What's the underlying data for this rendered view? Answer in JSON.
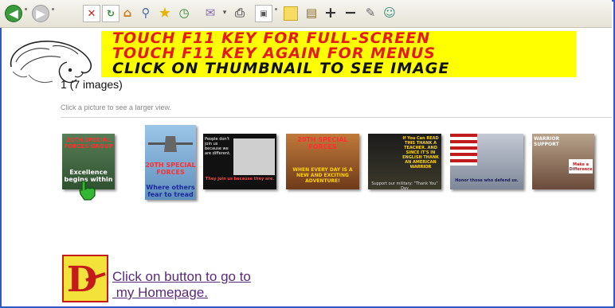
{
  "toolbar": {
    "icons": [
      "back-icon",
      "forward-icon",
      "stop-icon",
      "refresh-icon",
      "home-icon",
      "search-icon",
      "favorites-icon",
      "history-icon",
      "mail-icon",
      "print-icon",
      "edit-icon",
      "notes-icon",
      "research-icon",
      "zoom-in-icon",
      "zoom-out-icon",
      "messenger-icon",
      "people-icon"
    ],
    "zoom_in": "+",
    "zoom_out": "−"
  },
  "banner": {
    "line1": "TOUCH F11 KEY FOR FULL-SCREEN",
    "line2": "TOUCH F11 KEY AGAIN FOR MENUS",
    "line3": "CLICK ON THUMBNAIL TO SEE IMAGE",
    "background": "#ffff00",
    "accent_red": "#e31b1b"
  },
  "gallery": {
    "count": "1 (7 images)",
    "hint": "Click a picture to see a larger view.",
    "thumbnails": [
      {
        "caption_top": "20TH SPECIAL FORCES GROUP",
        "caption_bottom": "Excellence begins within"
      },
      {
        "caption_top": "20TH SPECIAL FORCES",
        "caption_bottom": "Where others fear to tread"
      },
      {
        "caption_top": "People don't join us because we are different.",
        "caption_bottom": "They join us because they are."
      },
      {
        "caption_top": "20TH SPECIAL FORCES",
        "caption_bottom": "WHEN EVERY DAY IS A NEW AND EXCITING ADVENTURE!"
      },
      {
        "caption_top": "If You Can READ THIS THANK A TEACHER. AND SINCE IT'S IN ENGLISH THANK AN AMERICAN WARRIOR",
        "caption_bottom": "Support our military: \"Thank You\" Day"
      },
      {
        "caption_top": "",
        "caption_bottom": "Honor those who defend us."
      },
      {
        "caption_top": "WARRIOR SUPPORT",
        "caption_bottom": "Make a Difference"
      }
    ]
  },
  "homepage": {
    "line1": "Click on button to go to",
    "line2": " my Homepage.",
    "button_letter": "D"
  }
}
